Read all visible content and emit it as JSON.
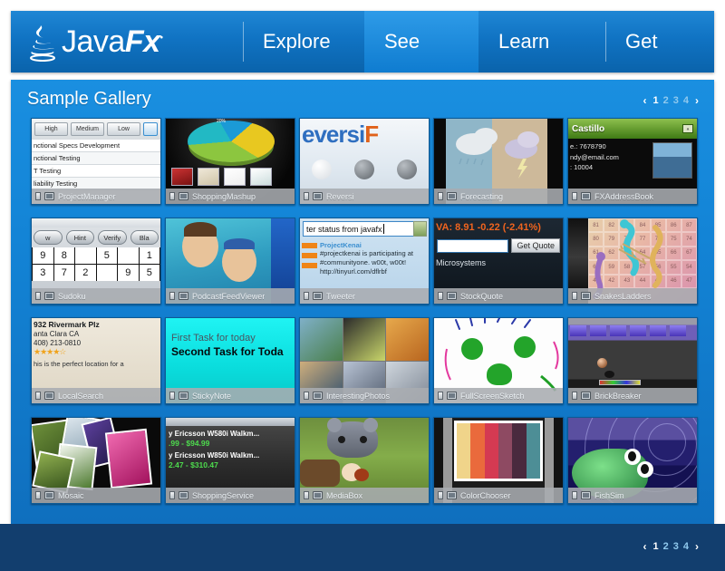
{
  "header": {
    "logo_text_java": "Java",
    "logo_text_fx": "Fx",
    "logo_tm": "®",
    "logo_icon": "java-coffee-cup-icon",
    "nav": [
      {
        "label": "Explore",
        "active": false
      },
      {
        "label": "See",
        "active": true
      },
      {
        "label": "Learn",
        "active": false
      },
      {
        "label": "Get",
        "active": false
      }
    ]
  },
  "gallery": {
    "title": "Sample Gallery",
    "pager": {
      "prev": "‹",
      "next": "›",
      "pages": [
        "1",
        "2",
        "3",
        "4"
      ],
      "active_page": "1"
    },
    "cards": [
      {
        "name": "ProjectManager",
        "buttons": [
          "High",
          "Medium",
          "Low"
        ],
        "rows": [
          "nctional Specs Development",
          "nctional Testing",
          "T Testing",
          "liability Testing"
        ]
      },
      {
        "name": "ShoppingMashup",
        "pie_label": "20%"
      },
      {
        "name": "Reversi",
        "title_part1": "eversi",
        "title_part2": "F"
      },
      {
        "name": "Forecasting"
      },
      {
        "name": "FXAddressBook",
        "contact": "Castillo",
        "phone": "e.: 7678790",
        "email": "ndy@email.com",
        "zip": ": 10004",
        "collapse_glyph": "-"
      },
      {
        "name": "Sudoku",
        "buttons": [
          "w",
          "Hint",
          "Verify",
          "Bla"
        ],
        "cells": [
          "9",
          "8",
          "",
          "5",
          "",
          "1",
          "3",
          "7",
          "2",
          "",
          "9",
          "5"
        ]
      },
      {
        "name": "PodcastFeedViewer"
      },
      {
        "name": "Tweeter",
        "input_value": "ter status from javafx",
        "tweet_user": "ProjectKenai",
        "tweet_line1": "#projectkenai is participating at",
        "tweet_line2": "#communityone. w00t, w00t!",
        "tweet_line3": "http://tinyurl.com/dflrbf"
      },
      {
        "name": "StockQuote",
        "ticker": "VA: 8.91 -0.22 (-2.41%)",
        "button": "Get Quote",
        "company": "Microsystems",
        "input_value": ""
      },
      {
        "name": "SnakesLadders",
        "numbers": [
          "81",
          "82",
          "83",
          "84",
          "85",
          "86",
          "87",
          "80",
          "79",
          "78",
          "77",
          "76",
          "75",
          "74",
          "61",
          "62",
          "63",
          "64",
          "65",
          "66",
          "67",
          "60",
          "59",
          "58",
          "57",
          "56",
          "55",
          "54",
          "41",
          "42",
          "43",
          "44",
          "45",
          "46",
          "47"
        ]
      },
      {
        "name": "LocalSearch",
        "address1": "932 Rivermark Plz",
        "address2": "anta Clara CA",
        "phone": "408) 213-0810",
        "stars": "★★★★☆",
        "review": "his is the perfect location for a"
      },
      {
        "name": "StickyNote",
        "task1": "First Task for today",
        "task2": "Second Task for Toda"
      },
      {
        "name": "InterestingPhotos"
      },
      {
        "name": "FullScreenSketch"
      },
      {
        "name": "BrickBreaker"
      },
      {
        "name": "Mosaic"
      },
      {
        "name": "ShoppingService",
        "product1": "y Ericsson W580i Walkm...",
        "price1": ".99 - $94.99",
        "product2": "y Ericsson W850i Walkm...",
        "price2": "2.47 - $310.47"
      },
      {
        "name": "MediaBox"
      },
      {
        "name": "ColorChooser"
      },
      {
        "name": "FishSim"
      }
    ]
  },
  "footer": {
    "pager": {
      "prev": "‹",
      "next": "›",
      "pages": [
        "1",
        "2",
        "3",
        "4"
      ],
      "active_page": "1"
    }
  },
  "colors": {
    "brand_blue": "#1073c3",
    "panel_blue": "#1384d6",
    "footer_navy": "#123e6e",
    "label_gray": "#a8acb0"
  }
}
